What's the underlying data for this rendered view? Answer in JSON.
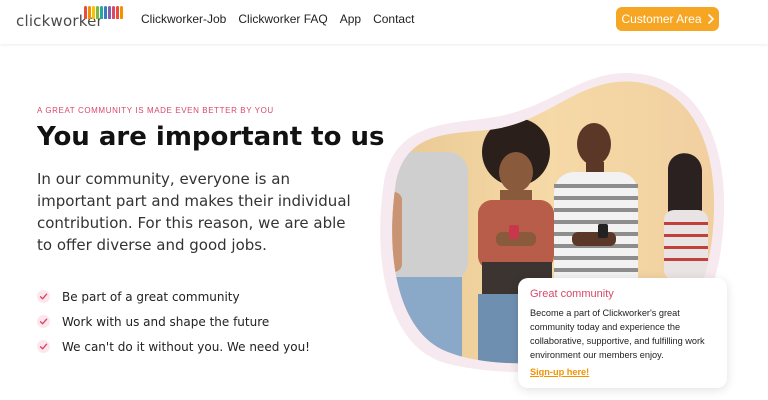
{
  "header": {
    "logo_text": "clickworker",
    "nav": [
      {
        "label": "Clickworker-Job"
      },
      {
        "label": "Clickworker FAQ"
      },
      {
        "label": "App"
      },
      {
        "label": "Contact"
      }
    ],
    "cta_label": "Customer Area",
    "cta_icon": "chevron-right-icon"
  },
  "hero": {
    "eyebrow": "A GREAT COMMUNITY IS MADE EVEN BETTER BY YOU",
    "headline": "You are important to us",
    "lead": "In our community, everyone is an important part and makes their individual contribution. For this reason, we are able to offer diverse and good jobs.",
    "checks": [
      {
        "text": "Be part of a great community"
      },
      {
        "text": "Work with us and shape the future"
      },
      {
        "text": "We can't do it without you. We need you!"
      }
    ]
  },
  "card": {
    "title": "Great community",
    "body": "Become a part of Clickworker's great community today and experience the collaborative, supportive, and fulfilling work environment our members enjoy.",
    "link": "Sign-up here!"
  },
  "colors": {
    "accent_orange": "#f6a623",
    "accent_pink": "#d9486a",
    "check_bg": "#fde7ec",
    "blob_bg": "#f6e9ef"
  }
}
